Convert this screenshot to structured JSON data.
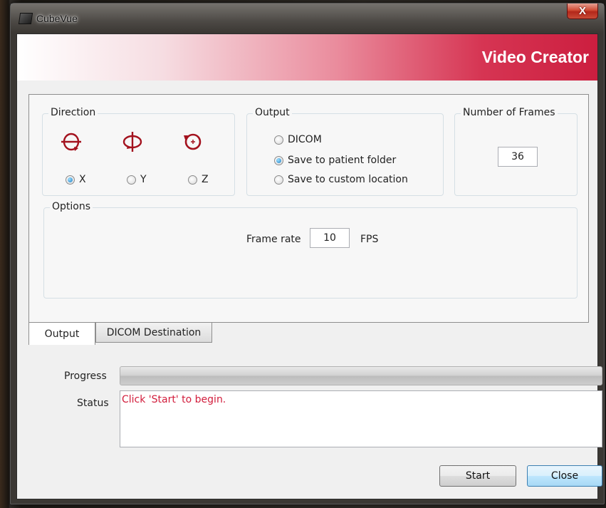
{
  "window": {
    "app_title": "CubeVue",
    "close_glyph": "X"
  },
  "banner": {
    "title": "Video Creator"
  },
  "direction": {
    "legend": "Direction",
    "icons": [
      "rotate-x-icon",
      "rotate-y-icon",
      "rotate-z-icon"
    ],
    "options": [
      {
        "label": "X",
        "checked": true
      },
      {
        "label": "Y",
        "checked": false
      },
      {
        "label": "Z",
        "checked": false
      }
    ]
  },
  "output": {
    "legend": "Output",
    "options": [
      {
        "label": "DICOM",
        "checked": false
      },
      {
        "label": "Save to patient folder",
        "checked": true
      },
      {
        "label": "Save to custom location",
        "checked": false
      }
    ]
  },
  "frames": {
    "legend": "Number of Frames",
    "value": "36"
  },
  "options": {
    "legend": "Options",
    "frame_rate_label": "Frame rate",
    "frame_rate_value": "10",
    "fps_label": "FPS"
  },
  "tabs": [
    {
      "label": "Output",
      "active": true
    },
    {
      "label": "DICOM Destination",
      "active": false
    }
  ],
  "progress": {
    "label": "Progress",
    "value": 0
  },
  "status": {
    "label": "Status",
    "text": "Click 'Start' to begin."
  },
  "buttons": {
    "start": "Start",
    "close": "Close"
  },
  "colors": {
    "accent": "#cc1e3f",
    "status_text": "#d21d3c",
    "icon_red": "#a3121e"
  }
}
